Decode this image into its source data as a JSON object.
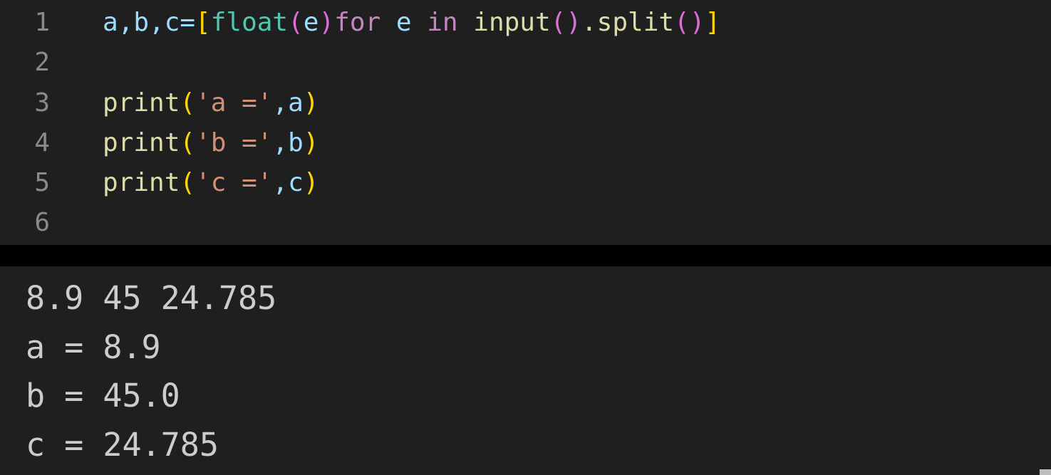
{
  "editor": {
    "lines": [
      {
        "number": "1",
        "tokens": [
          {
            "text": "a,b,c=",
            "color": "#9cdcfe"
          },
          {
            "text": "[",
            "color": "#ffd700"
          },
          {
            "text": "float",
            "color": "#4ec9b0"
          },
          {
            "text": "(",
            "color": "#da70d6"
          },
          {
            "text": "e",
            "color": "#9cdcfe"
          },
          {
            "text": ")",
            "color": "#da70d6"
          },
          {
            "text": "for",
            "color": "#c586c0"
          },
          {
            "text": " e ",
            "color": "#9cdcfe"
          },
          {
            "text": "in",
            "color": "#c586c0"
          },
          {
            "text": " input",
            "color": "#dcdcaa"
          },
          {
            "text": "()",
            "color": "#da70d6"
          },
          {
            "text": ".split",
            "color": "#dcdcaa"
          },
          {
            "text": "()",
            "color": "#da70d6"
          },
          {
            "text": "]",
            "color": "#ffd700"
          }
        ]
      },
      {
        "number": "2",
        "tokens": []
      },
      {
        "number": "3",
        "tokens": [
          {
            "text": "print",
            "color": "#dcdcaa"
          },
          {
            "text": "(",
            "color": "#ffd700"
          },
          {
            "text": "'a ='",
            "color": "#ce9178"
          },
          {
            "text": ",a",
            "color": "#9cdcfe"
          },
          {
            "text": ")",
            "color": "#ffd700"
          }
        ]
      },
      {
        "number": "4",
        "tokens": [
          {
            "text": "print",
            "color": "#dcdcaa"
          },
          {
            "text": "(",
            "color": "#ffd700"
          },
          {
            "text": "'b ='",
            "color": "#ce9178"
          },
          {
            "text": ",b",
            "color": "#9cdcfe"
          },
          {
            "text": ")",
            "color": "#ffd700"
          }
        ]
      },
      {
        "number": "5",
        "tokens": [
          {
            "text": "print",
            "color": "#dcdcaa"
          },
          {
            "text": "(",
            "color": "#ffd700"
          },
          {
            "text": "'c ='",
            "color": "#ce9178"
          },
          {
            "text": ",c",
            "color": "#9cdcfe"
          },
          {
            "text": ")",
            "color": "#ffd700"
          }
        ]
      },
      {
        "number": "6",
        "tokens": []
      }
    ]
  },
  "terminal": {
    "lines": [
      "8.9 45 24.785",
      "a = 8.9",
      "b = 45.0",
      "c = 24.785"
    ]
  }
}
